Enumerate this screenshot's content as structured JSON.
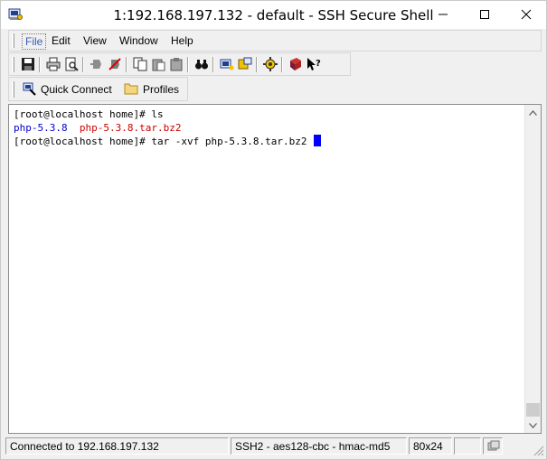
{
  "window": {
    "title": "1:192.168.197.132 - default - SSH Secure Shell",
    "controls": {
      "minimize": "–",
      "maximize": "□",
      "close": "✕"
    }
  },
  "menubar": {
    "items": [
      {
        "label": "File",
        "active": true
      },
      {
        "label": "Edit"
      },
      {
        "label": "View"
      },
      {
        "label": "Window"
      },
      {
        "label": "Help"
      }
    ]
  },
  "toolbar": {
    "buttons": [
      {
        "icon": "save-icon"
      },
      {
        "icon": "print-icon"
      },
      {
        "icon": "print-preview-icon"
      },
      {
        "icon": "connect-icon"
      },
      {
        "icon": "disconnect-icon"
      },
      {
        "icon": "copy-icon"
      },
      {
        "icon": "paste-icon"
      },
      {
        "icon": "paste-special-icon"
      },
      {
        "icon": "find-icon"
      },
      {
        "icon": "new-terminal-icon"
      },
      {
        "icon": "new-file-transfer-icon"
      },
      {
        "icon": "settings-icon"
      },
      {
        "icon": "help-book-icon"
      },
      {
        "icon": "context-help-icon"
      }
    ]
  },
  "profilesbar": {
    "quick_connect_label": "Quick Connect",
    "profiles_label": "Profiles"
  },
  "terminal": {
    "lines": [
      {
        "segments": [
          {
            "text": "[root@localhost home]# ls",
            "color": "default"
          }
        ]
      },
      {
        "segments": [
          {
            "text": "php-5.3.8",
            "color": "blue"
          },
          {
            "text": "  ",
            "color": "default"
          },
          {
            "text": "php-5.3.8.tar.bz2",
            "color": "red"
          }
        ]
      },
      {
        "segments": [
          {
            "text": "[root@localhost home]# tar -xvf php-5.3.8.tar.bz2 ",
            "color": "default"
          }
        ],
        "cursor": true
      }
    ],
    "colors": {
      "blue": "#0000cc",
      "red": "#cc0000",
      "cursor": "#0000ff"
    }
  },
  "statusbar": {
    "connection": "Connected to 192.168.197.132",
    "cipher": "SSH2 - aes128-cbc - hmac-md5",
    "size": "80x24"
  }
}
